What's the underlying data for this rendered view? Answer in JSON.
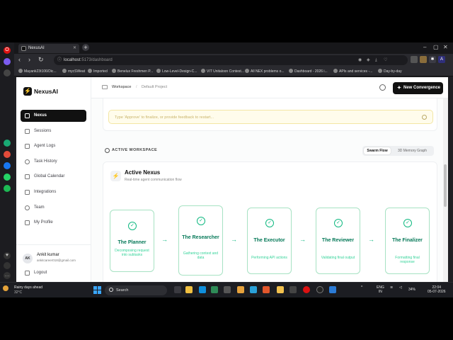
{
  "browser": {
    "tab_title": "NexusAI",
    "url_host": "localhost",
    "url_path": ":5173/dashboard"
  },
  "bookmarks": [
    "Mayank23t106/Dic...",
    "mycSWeat",
    "Imported",
    "Benelux Freshmen P...",
    "Low-Level-Design-C...",
    "VIT Unitaloon Contest...",
    "All NEX problems o...",
    "Dashboard - 2026 i...",
    "APIs and services -...",
    "Day-by-day"
  ],
  "app": {
    "name": "NexusAI",
    "nav": [
      "Nexus",
      "Sessions",
      "Agent Logs",
      "Task History",
      "Global Calendar",
      "Integrations",
      "Team",
      "My Profile"
    ],
    "user": {
      "initials": "AK",
      "name": "Ankit kumar",
      "email": "ankitcareer018@gmail.com"
    },
    "logout": "Logout"
  },
  "topbar": {
    "breadcrumb_root": "Workspace",
    "breadcrumb_sep": "/",
    "breadcrumb_current": "Default Project",
    "new_button": "New Convergence"
  },
  "feedback": {
    "placeholder": "Type 'Approve' to finalize, or provide feedback to restart..."
  },
  "workspace": {
    "label": "ACTIVE WORKSPACE",
    "view_options": [
      "Swarm Flow",
      "3D Memory Graph"
    ]
  },
  "nexus": {
    "title": "Active Nexus",
    "subtitle": "Real-time agent communication flow",
    "agents": [
      {
        "title": "The Planner",
        "description": "Decomposing request into subtasks"
      },
      {
        "title": "The Researcher",
        "description": "Gathering context and data"
      },
      {
        "title": "The Executor",
        "description": "Performing API actions"
      },
      {
        "title": "The Reviewer",
        "description": "Validating final output"
      },
      {
        "title": "The Finalizer",
        "description": "Formatting final response"
      }
    ]
  },
  "taskbar": {
    "weather_line1": "Rainy days ahead",
    "weather_line2": "32°C",
    "search": "Search",
    "lang_a": "ENG",
    "lang_b": "IN",
    "battery": "34%",
    "time": "22:04",
    "date": "05-07-2026"
  }
}
